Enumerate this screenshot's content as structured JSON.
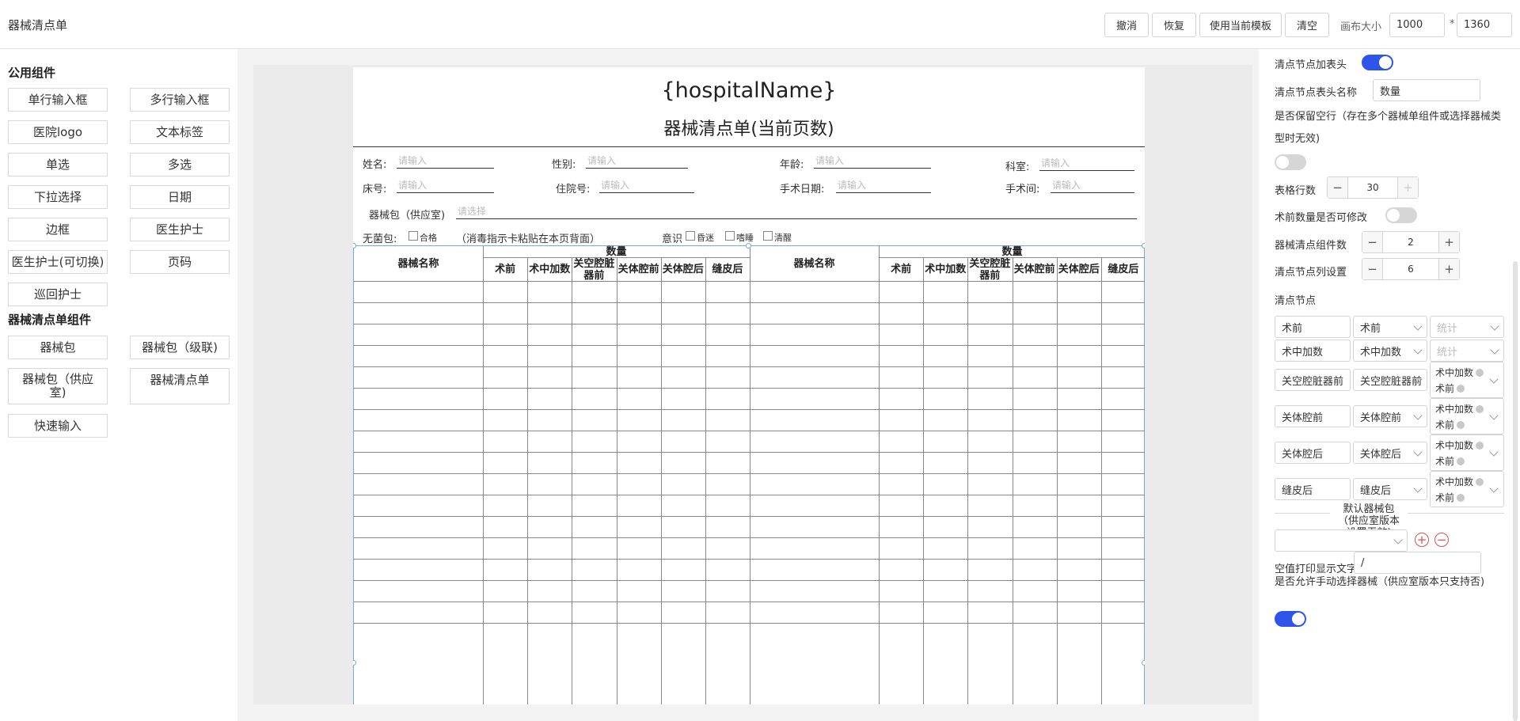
{
  "app": {
    "title": "器械清点单"
  },
  "toolbar": {
    "undo": "撤消",
    "redo": "恢复",
    "use_template": "使用当前模板",
    "clear": "清空",
    "canvas_size_label": "画布大小",
    "canvas_width": "1000",
    "times": "*",
    "canvas_height": "1360"
  },
  "left": {
    "common_title": "公用组件",
    "common_items": [
      "单行输入框",
      "多行输入框",
      "医院logo",
      "文本标签",
      "单选",
      "多选",
      "下拉选择",
      "日期",
      "边框",
      "医生护士",
      "医生护士(可切换)",
      "页码",
      "巡回护士"
    ],
    "instrument_title": "器械清点单组件",
    "instrument_items": [
      "器械包",
      "器械包（级联)",
      "器械包（供应室)",
      "器械清点单",
      "快速输入"
    ]
  },
  "paper": {
    "hospital_name": "{hospitalName}",
    "form_title": "器械清点单(当前页数)",
    "fields": {
      "name_label": "姓名:",
      "gender_label": "性别:",
      "age_label": "年龄:",
      "dept_label": "科室:",
      "bed_label": "床号:",
      "admission_label": "住院号:",
      "surgery_date_label": "手术日期:",
      "or_label": "手术间:",
      "placeholder": "请输入",
      "pack_label": "器械包（供应室)",
      "pack_placeholder": "请选择"
    },
    "sterile_label": "无菌包:",
    "sterile_option": "合格",
    "sterile_note": "（消毒指示卡粘贴在本页背面）",
    "consciousness_label": "意识",
    "consciousness_options": [
      "昏迷",
      "嗜睡",
      "清醒"
    ],
    "table": {
      "name_header": "器械名称",
      "qty_header": "数量",
      "columns": [
        "术前",
        "术中加数",
        "关空腔脏器前",
        "关体腔前",
        "关体腔后",
        "缝皮后"
      ],
      "row_count": 16
    }
  },
  "right": {
    "header_label": "清点节点加表头",
    "header_on": true,
    "header_name_label": "清点节点表头名称",
    "header_name_value": "数量",
    "keep_empty_label": "是否保留空行（存在多个器械单组件或选择器械类型时无效)",
    "keep_empty_on": false,
    "rows_label": "表格行数",
    "rows_value": "30",
    "preop_editable_label": "术前数量是否可修改",
    "preop_editable_on": false,
    "component_count_label": "器械清点组件数",
    "component_count_value": "2",
    "col_setting_label": "清点节点列设置",
    "col_setting_value": "6",
    "nodes_title": "清点节点",
    "nodes": [
      {
        "name": "术前",
        "type": "术前",
        "stat": "统计",
        "tags": []
      },
      {
        "name": "术中加数",
        "type": "术中加数",
        "stat": "统计",
        "tags": []
      },
      {
        "name": "关空腔脏器前",
        "type": "关空腔脏器前",
        "stat": "",
        "tags": [
          "术中加数",
          "术前"
        ]
      },
      {
        "name": "关体腔前",
        "type": "关体腔前",
        "stat": "",
        "tags": [
          "术中加数",
          "术前"
        ]
      },
      {
        "name": "关体腔后",
        "type": "关体腔后",
        "stat": "",
        "tags": [
          "术中加数",
          "术前"
        ]
      },
      {
        "name": "缝皮后",
        "type": "缝皮后",
        "stat": "",
        "tags": [
          "术中加数",
          "术前"
        ]
      }
    ],
    "default_pack_label": "默认器械包（供应室版本设置无效)",
    "empty_print_label": "空值打印显示文字",
    "empty_print_value": "/",
    "manual_select_label": "是否允许手动选择器械（供应室版本只支持否)",
    "manual_select_on": true
  }
}
